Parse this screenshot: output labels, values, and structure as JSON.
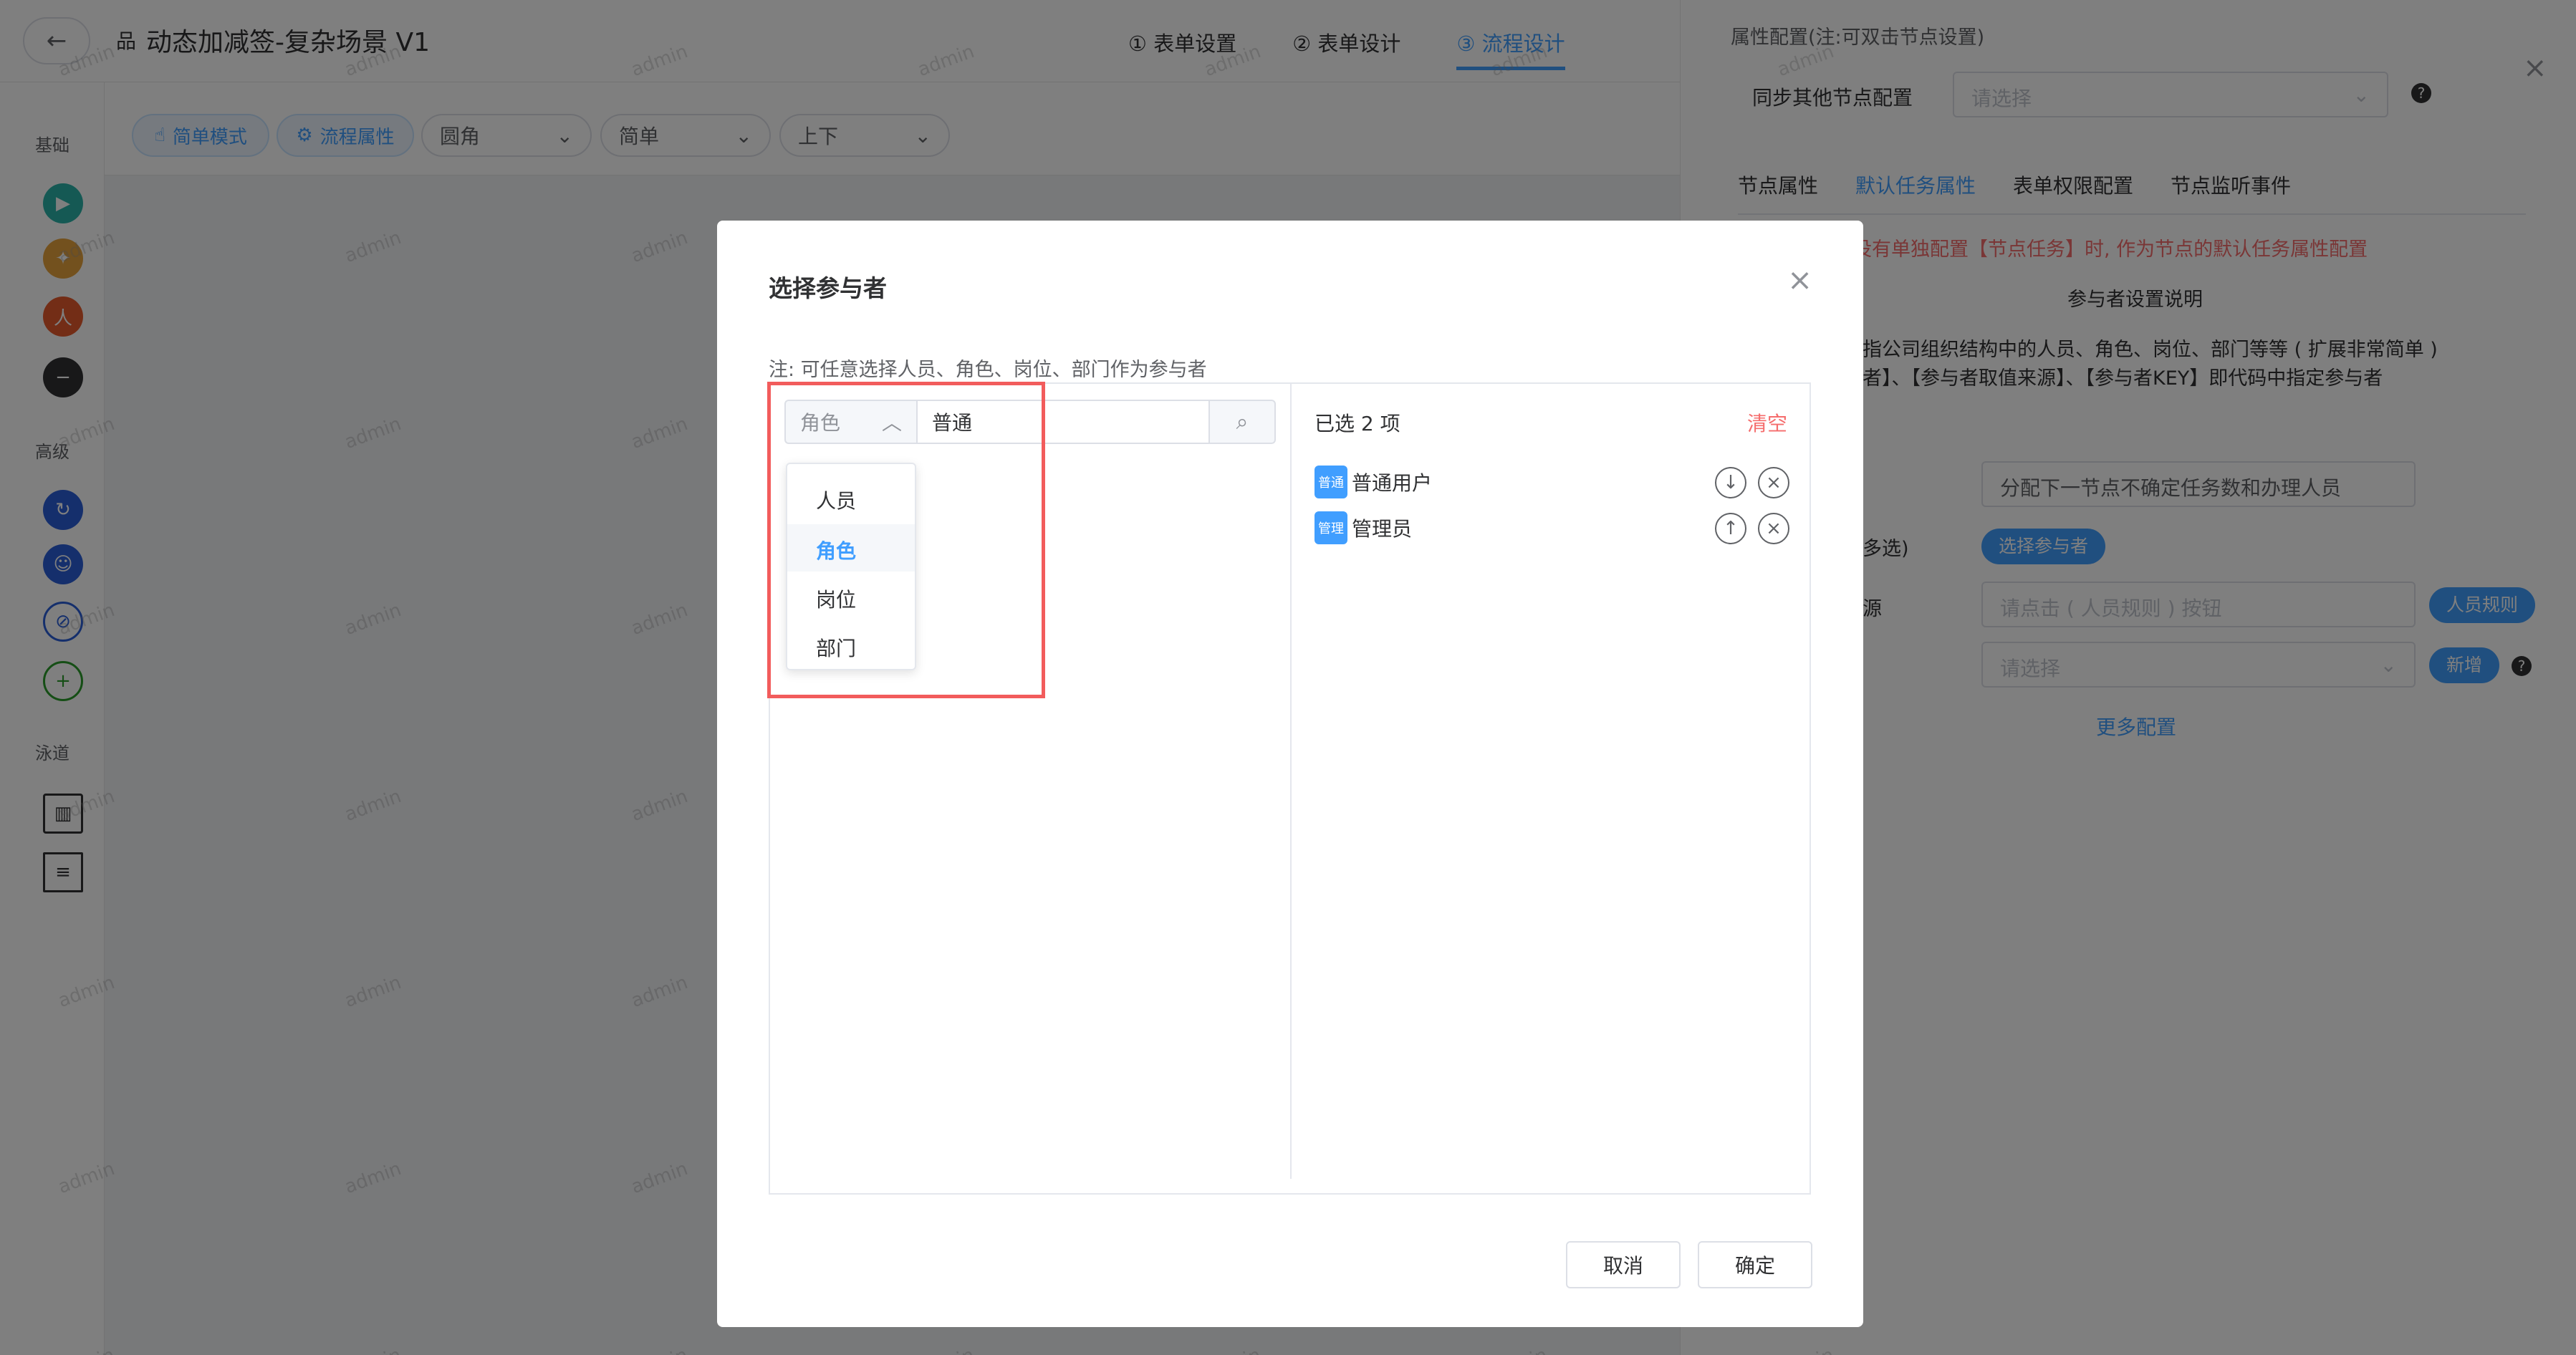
{
  "header": {
    "back_label": "←",
    "title": "动态加减签-复杂场景 V1",
    "steps": [
      "① 表单设置",
      "② 表单设计",
      "③ 流程设计"
    ]
  },
  "leftbar": {
    "section_basic": "基础",
    "section_advanced": "高级",
    "section_lane": "泳道"
  },
  "toolbar": {
    "simple_mode": "简单模式",
    "process_props": "流程属性",
    "select1": "圆角",
    "select2": "简单",
    "select3": "上下"
  },
  "right_panel": {
    "title": "属性配置(注:可双击节点设置)",
    "sync_label": "同步其他节点配置",
    "sync_placeholder": "请选择",
    "tabs": [
      "节点属性",
      "默认任务属性",
      "表单权限配置",
      "节点监听事件"
    ],
    "notice": "没有单独配置【节点任务】时, 作为节点的默认任务属性配置",
    "section_title": "参与者设置说明",
    "desc_line1": "指公司组织结构中的人员、角色、岗位、部门等等 ( 扩展非常简单 )",
    "desc_line2": "者】、【参与者取值来源】、【参与者KEY】即代码中指定参与者",
    "field1_value": "分配下一节点不确定任务数和办理人员",
    "field2_label": "多选)",
    "field2_button": "选择参与者",
    "field3_label": "源",
    "field3_placeholder": "请点击 ( 人员规则 ) 按钮",
    "field3_button": "人员规则",
    "field4_placeholder": "请选择",
    "field4_button": "新增",
    "more_config": "更多配置"
  },
  "dialog": {
    "title": "选择参与者",
    "note": "注: 可任意选择人员、角色、岗位、部门作为参与者",
    "type_select_value": "角色",
    "search_value": "普通",
    "dropdown_options": [
      "人员",
      "角色",
      "岗位",
      "部门"
    ],
    "selected_option": "角色",
    "result_partial": "户",
    "selected_count_label": "已选 2 项",
    "clear_label": "清空",
    "selected_items": [
      {
        "chip": "普通",
        "name": "普通用户",
        "move": "↓"
      },
      {
        "chip": "管理",
        "name": "管理员",
        "move": "↑"
      }
    ],
    "cancel_label": "取消",
    "confirm_label": "确定"
  },
  "watermark_text": "admin",
  "colors": {
    "primary": "#409eff",
    "danger": "#f56c6c",
    "highlight_box": "#f25c5c"
  }
}
